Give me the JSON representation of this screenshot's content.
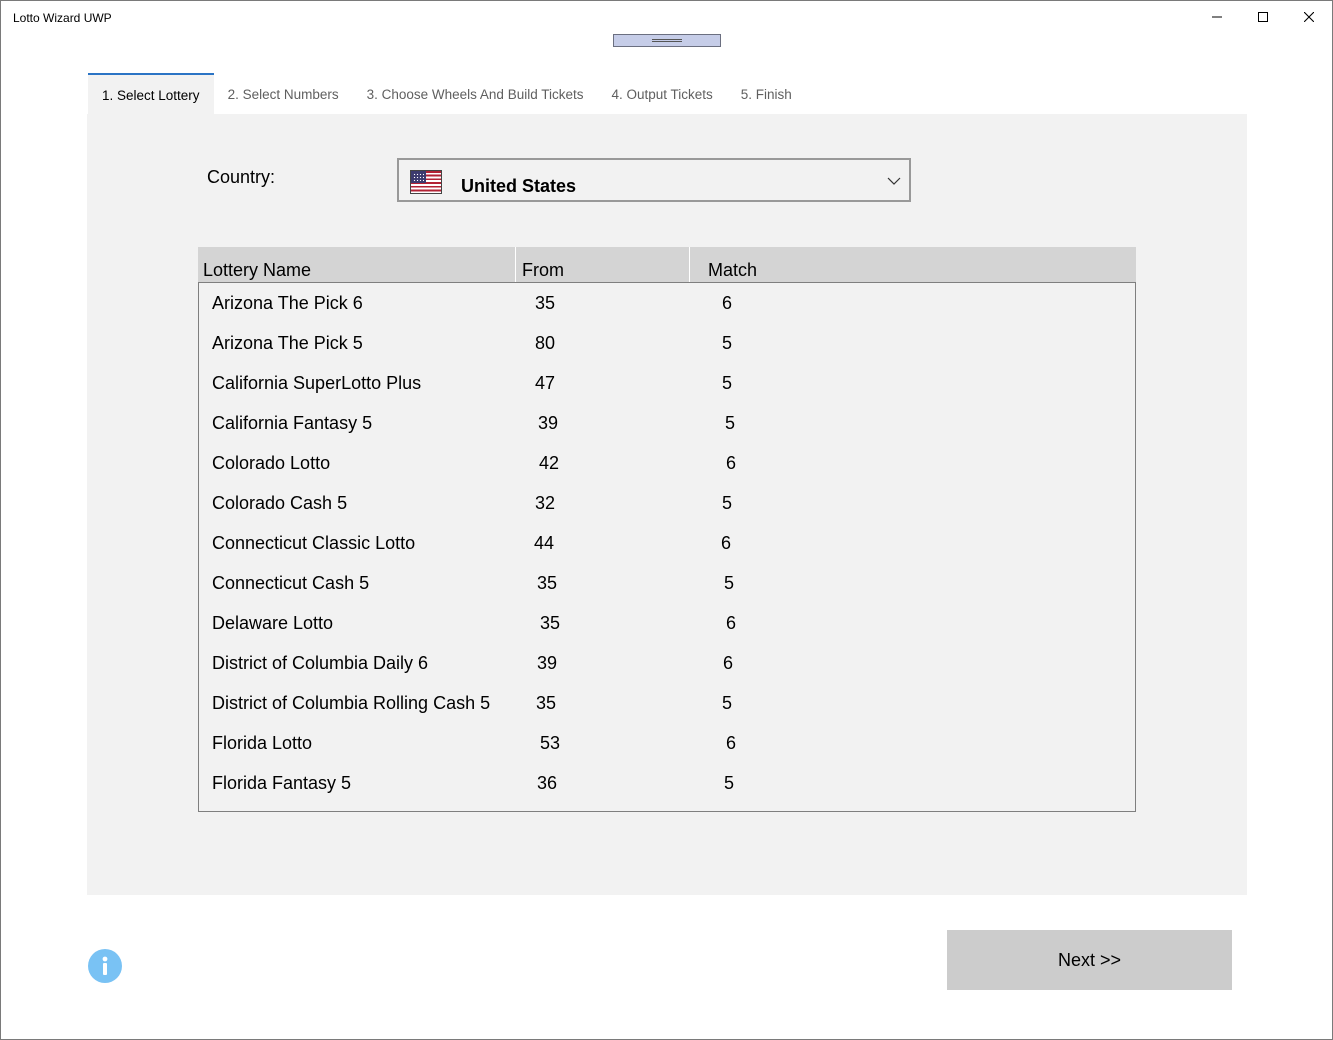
{
  "window": {
    "title": "Lotto Wizard UWP"
  },
  "tabs": [
    {
      "label": "1. Select Lottery",
      "active": true
    },
    {
      "label": "2. Select Numbers",
      "active": false
    },
    {
      "label": "3. Choose Wheels And Build Tickets",
      "active": false
    },
    {
      "label": "4. Output Tickets",
      "active": false
    },
    {
      "label": "5. Finish",
      "active": false
    }
  ],
  "country": {
    "label": "Country:",
    "selected": "United States",
    "flag_icon": "us-flag-icon"
  },
  "grid": {
    "headers": {
      "name": "Lottery Name",
      "from": "From",
      "match": "Match"
    },
    "rows": [
      {
        "name": "Arizona The Pick 6",
        "from": "35",
        "match": "6"
      },
      {
        "name": "Arizona The Pick 5",
        "from": "80",
        "match": "5"
      },
      {
        "name": "California SuperLotto Plus",
        "from": "47",
        "match": "5"
      },
      {
        "name": "California Fantasy 5",
        "from": "39",
        "match": "5"
      },
      {
        "name": "Colorado Lotto",
        "from": "42",
        "match": "6"
      },
      {
        "name": "Colorado Cash 5",
        "from": "32",
        "match": "5"
      },
      {
        "name": "Connecticut Classic Lotto",
        "from": "44",
        "match": "6"
      },
      {
        "name": "Connecticut Cash 5",
        "from": "35",
        "match": "5"
      },
      {
        "name": "Delaware Lotto",
        "from": "35",
        "match": "6"
      },
      {
        "name": "District of Columbia Daily 6",
        "from": "39",
        "match": "6"
      },
      {
        "name": "District of Columbia Rolling Cash 5",
        "from": "35",
        "match": "5"
      },
      {
        "name": "Florida Lotto",
        "from": "53",
        "match": "6"
      },
      {
        "name": "Florida Fantasy 5",
        "from": "36",
        "match": "5"
      }
    ]
  },
  "footer": {
    "next_label": "Next >>",
    "info_icon": "info-icon"
  },
  "colors": {
    "accent": "#2b74c5",
    "panel_bg": "#f2f2f2",
    "header_bg": "#d4d4d4",
    "button_bg": "#cccccc",
    "info_icon": "#79c2f4"
  }
}
